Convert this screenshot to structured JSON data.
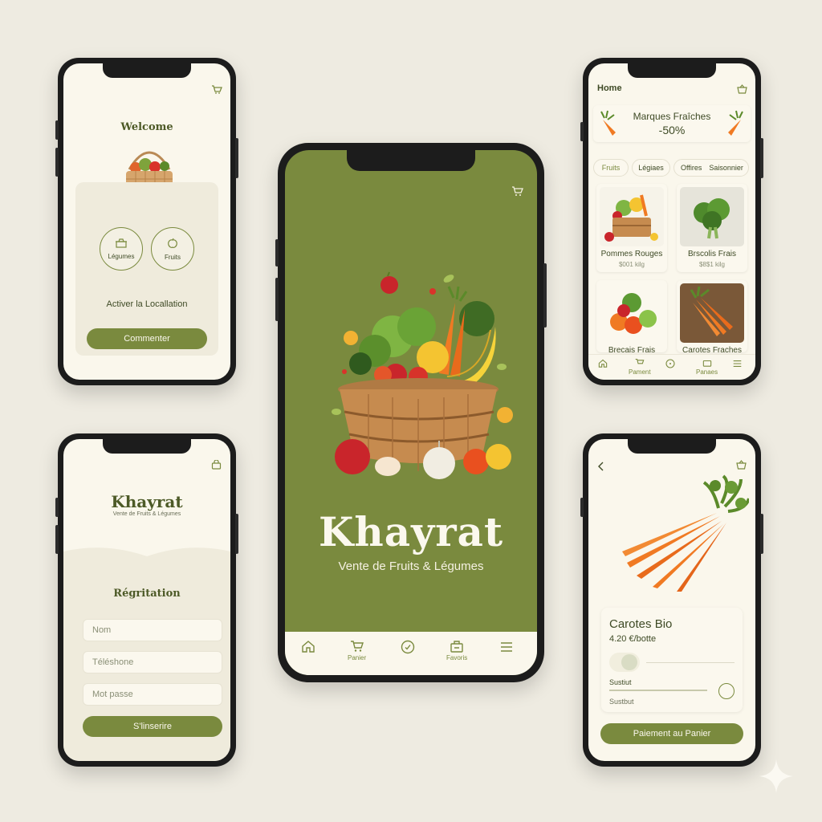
{
  "welcome_screen": {
    "title": "Welcome",
    "options": [
      {
        "label": "Légumes",
        "icon": "vegetable-box-icon"
      },
      {
        "label": "Fruits",
        "icon": "fruit-icon"
      }
    ],
    "location_label": "Activer la Locallation",
    "start_button": "Commenter"
  },
  "register_screen": {
    "brand": "Khayrat",
    "tagline": "Vente de Fruits & Légumes",
    "title": "Régritation",
    "fields": [
      {
        "placeholder": "Nom"
      },
      {
        "placeholder": "Téléshone"
      },
      {
        "placeholder": "Mot passe"
      }
    ],
    "submit_button": "S'linserire"
  },
  "splash_screen": {
    "brand": "Khayrat",
    "tagline": "Vente de Fruits & Légumes",
    "tabs": [
      {
        "label": "",
        "icon": "home-icon"
      },
      {
        "label": "Panier",
        "icon": "cart-icon"
      },
      {
        "label": "",
        "icon": "check-icon"
      },
      {
        "label": "Favoris",
        "icon": "favorites-icon"
      },
      {
        "label": "",
        "icon": "menu-icon"
      }
    ]
  },
  "home_screen": {
    "title": "Home",
    "banner_title": "Marques Fraîches",
    "banner_discount": "-50%",
    "chips": [
      "Fruits",
      "Légiaes",
      "Offires",
      "Saisonnier"
    ],
    "products": [
      {
        "name": "Pommes Rouges",
        "price": "$001 kilg"
      },
      {
        "name": "Brscolis Frais",
        "price": "$8$1 kilg"
      },
      {
        "name": "Brecais Frais",
        "price": ""
      },
      {
        "name": "Carotes Fraches",
        "price": ""
      }
    ],
    "tabs": [
      {
        "label": "",
        "icon": "home-icon"
      },
      {
        "label": "Pament",
        "icon": "cart-icon"
      },
      {
        "label": "",
        "icon": "check-icon"
      },
      {
        "label": "Panaes",
        "icon": "favorites-icon"
      },
      {
        "label": "",
        "icon": "menu-icon"
      }
    ]
  },
  "detail_screen": {
    "product_name": "Carotes Bio",
    "price": "4.20 €/botte",
    "option1": "Sustiut",
    "option2": "Sustbut",
    "add_button": "Paiement au Panier"
  },
  "colors": {
    "accent": "#7a8a3e",
    "background": "#eeebe1",
    "screen": "#faf7ec",
    "text": "#3e4a25"
  }
}
